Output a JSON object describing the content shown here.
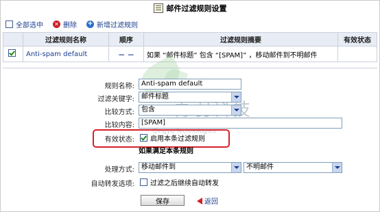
{
  "title": "邮件过滤规则设置",
  "toolbar": {
    "select_all": "全部选中",
    "delete": "删除",
    "add_rule": "新增过滤规则"
  },
  "table": {
    "headers": [
      "过滤规则名称",
      "顺序",
      "过滤规则摘要",
      "有效状态"
    ],
    "rows": [
      {
        "name": "Anti-spam default",
        "order": "－ －",
        "summary": "如果 “邮件标题” 包含 “[SPAM]” ，移动邮件到不明邮件",
        "status": ""
      }
    ]
  },
  "form": {
    "rule_name_label": "规则名称:",
    "rule_name_value": "Anti-spam default",
    "keyword_label": "过滤关键字:",
    "keyword_value": "邮件标题",
    "compare_label": "比较方式:",
    "compare_value": "包含",
    "content_label": "比较内容:",
    "content_value": "[SPAM]",
    "status_label": "有效状态:",
    "status_checkbox_label": "启用本条过滤规则",
    "subheading": "如果满足本条规则",
    "action_label": "处理方式:",
    "action_value": "移动邮件到",
    "action_target_value": "不明邮件",
    "forward_label": "自动转发选项:",
    "forward_checkbox_label": "过滤之后继续自动转发",
    "save_button": "保存",
    "back_link": "返回"
  },
  "watermark": {
    "zh": "青羽科技",
    "en": "Qingyu Technologies"
  },
  "colors": {
    "header_bg": "#e8ecf4",
    "link": "#1a3e8c",
    "highlight": "#d4202a"
  }
}
